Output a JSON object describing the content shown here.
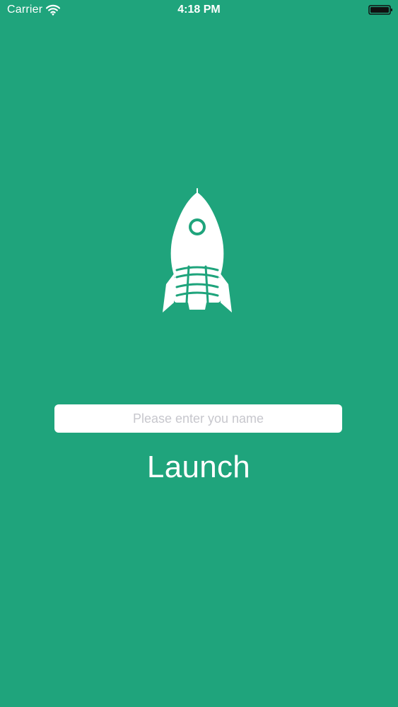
{
  "status_bar": {
    "carrier": "Carrier",
    "time": "4:18 PM",
    "wifi_icon": "wifi-icon",
    "battery_icon": "battery-icon"
  },
  "main": {
    "hero_icon": "rocket-icon",
    "name_input": {
      "value": "",
      "placeholder": "Please enter you name"
    },
    "launch_label": "Launch"
  },
  "colors": {
    "background": "#1fa47c",
    "foreground": "#ffffff",
    "input_background": "#ffffff",
    "placeholder": "#c7c7cd"
  }
}
